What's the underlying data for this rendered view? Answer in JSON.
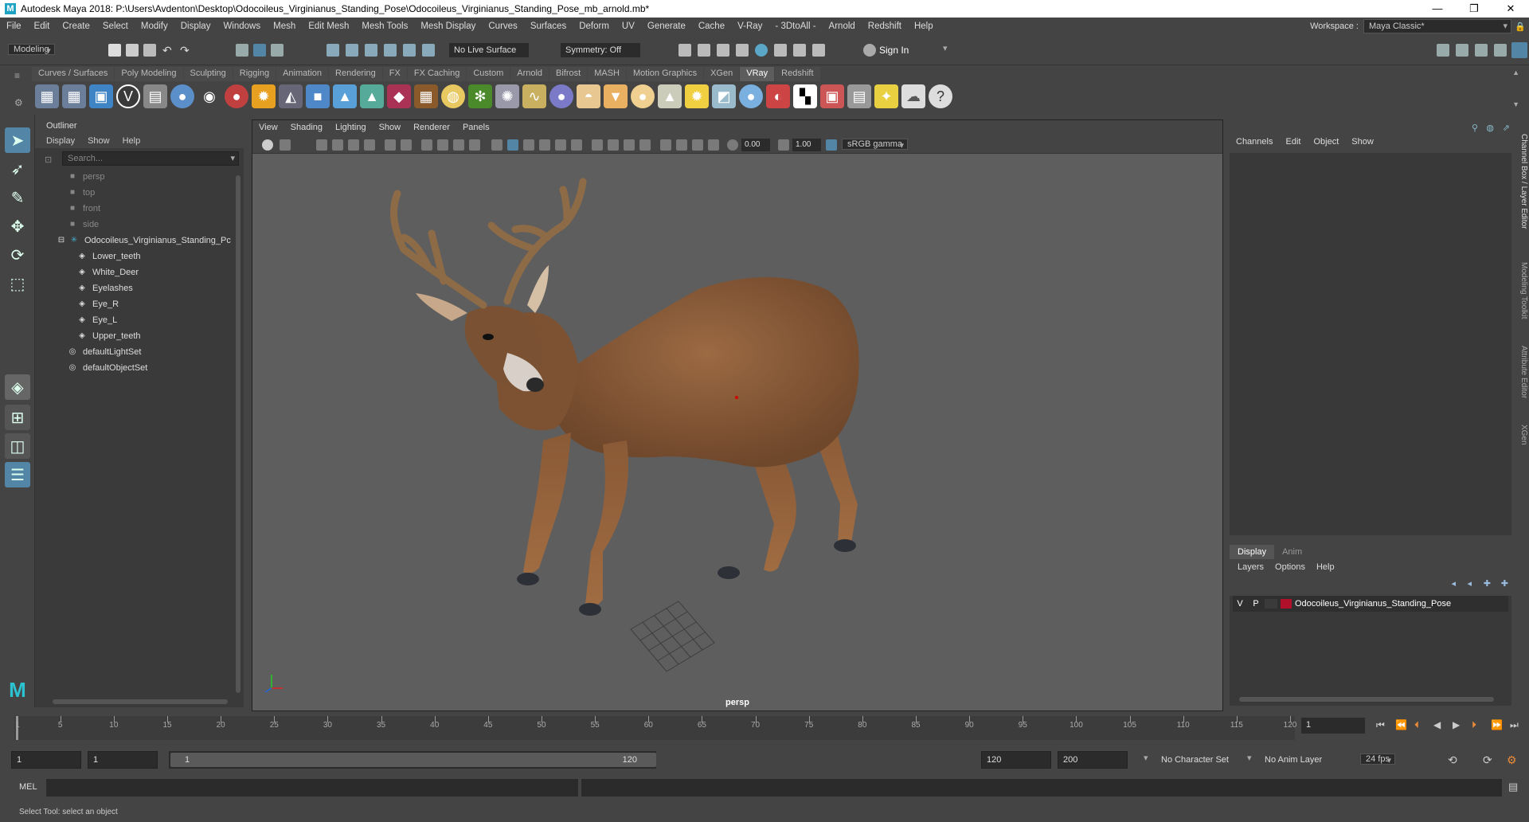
{
  "window": {
    "title": "Autodesk Maya 2018: P:\\Users\\Avdenton\\Desktop\\Odocoileus_Virginianus_Standing_Pose\\Odocoileus_Virginianus_Standing_Pose_mb_arnold.mb*",
    "app_letter": "M"
  },
  "menubar": {
    "items": [
      "File",
      "Edit",
      "Create",
      "Select",
      "Modify",
      "Display",
      "Windows",
      "Mesh",
      "Edit Mesh",
      "Mesh Tools",
      "Mesh Display",
      "Curves",
      "Surfaces",
      "Deform",
      "UV",
      "Generate",
      "Cache",
      "V-Ray",
      "- 3DtoAll -",
      "Arnold",
      "Redshift",
      "Help"
    ],
    "workspace_label": "Workspace :",
    "workspace_value": "Maya Classic*"
  },
  "statusline": {
    "menuset": "Modeling",
    "live_surface": "No Live Surface",
    "symmetry": "Symmetry: Off",
    "sign_in": "Sign In"
  },
  "shelf": {
    "tabs": [
      "Curves / Surfaces",
      "Poly Modeling",
      "Sculpting",
      "Rigging",
      "Animation",
      "Rendering",
      "FX",
      "FX Caching",
      "Custom",
      "Arnold",
      "Bifrost",
      "MASH",
      "Motion Graphics",
      "XGen",
      "VRay",
      "Redshift"
    ],
    "active_tab": "VRay"
  },
  "outliner": {
    "title": "Outliner",
    "menus": [
      "Display",
      "Show",
      "Help"
    ],
    "search_placeholder": "Search...",
    "items": [
      {
        "label": "persp",
        "type": "camera"
      },
      {
        "label": "top",
        "type": "camera"
      },
      {
        "label": "front",
        "type": "camera"
      },
      {
        "label": "side",
        "type": "camera"
      },
      {
        "label": "Odocoileus_Virginianus_Standing_Pc",
        "type": "group"
      },
      {
        "label": "Lower_teeth",
        "type": "mesh"
      },
      {
        "label": "White_Deer",
        "type": "mesh"
      },
      {
        "label": "Eyelashes",
        "type": "mesh"
      },
      {
        "label": "Eye_R",
        "type": "mesh"
      },
      {
        "label": "Eye_L",
        "type": "mesh"
      },
      {
        "label": "Upper_teeth",
        "type": "mesh"
      },
      {
        "label": "defaultLightSet",
        "type": "set"
      },
      {
        "label": "defaultObjectSet",
        "type": "set"
      }
    ]
  },
  "viewport": {
    "menus": [
      "View",
      "Shading",
      "Lighting",
      "Show",
      "Renderer",
      "Panels"
    ],
    "exposure": "0.00",
    "gamma": "1.00",
    "color_space": "sRGB gamma",
    "camera_label": "persp"
  },
  "channelbox": {
    "menus": [
      "Channels",
      "Edit",
      "Object",
      "Show"
    ],
    "layer_tabs": [
      "Display",
      "Anim"
    ],
    "layer_menus": [
      "Layers",
      "Options",
      "Help"
    ],
    "layer": {
      "v": "V",
      "p": "P",
      "name": "Odocoileus_Virginianus_Standing_Pose",
      "color": "#b0102a"
    }
  },
  "side_tabs": [
    "Channel Box / Layer Editor",
    "Modeling Toolkit",
    "Attribute Editor",
    "XGen"
  ],
  "timeslider": {
    "ticks": [
      1,
      5,
      10,
      15,
      20,
      25,
      30,
      35,
      40,
      45,
      50,
      55,
      60,
      65,
      70,
      75,
      80,
      85,
      90,
      95,
      100,
      105,
      110,
      115,
      120
    ],
    "current_frame": "1"
  },
  "rangeslider": {
    "start": "1",
    "inner_start": "1",
    "range_start_label": "1",
    "range_end_label": "120",
    "end": "120",
    "anim_end": "200",
    "character_set": "No Character Set",
    "anim_layer": "No Anim Layer",
    "fps": "24 fps"
  },
  "commandline": {
    "label": "MEL"
  },
  "helpline": {
    "text": "Select Tool: select an object"
  },
  "colors": {
    "accent": "#5285a6",
    "layer_color": "#b0102a",
    "viewport_bg": "#5e5e5e"
  }
}
